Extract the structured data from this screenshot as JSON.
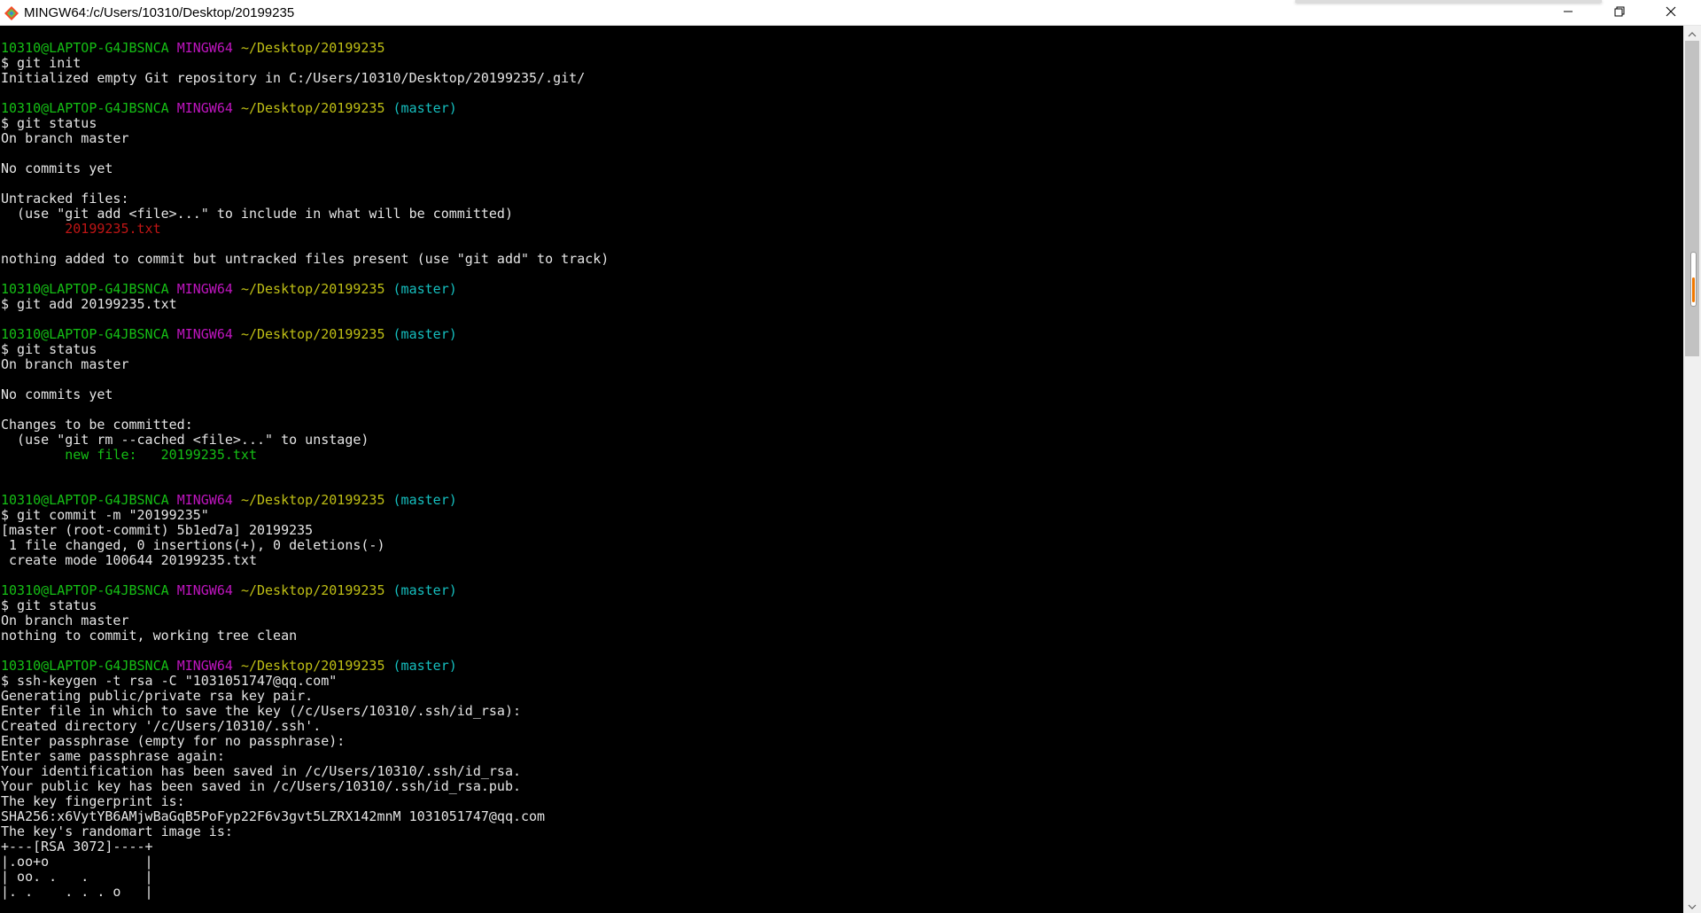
{
  "window": {
    "title": "MINGW64:/c/Users/10310/Desktop/20199235",
    "icon": "git-bash-icon",
    "controls": [
      "minimize-icon",
      "maximize-icon",
      "close-icon"
    ]
  },
  "colors": {
    "user_host": "#15bf15",
    "mingw": "#bf15bf",
    "path": "#bfbf15",
    "branch": "#15bfbf",
    "untracked": "#bf1515",
    "staged": "#15bf15",
    "text": "#e5e5e5",
    "background": "#000000"
  },
  "terminal": {
    "lines": [
      {
        "segs": [
          {
            "t": "10310@LAPTOP-G4JBSNCA",
            "c": "user"
          },
          {
            "t": " "
          },
          {
            "t": "MINGW64",
            "c": "host"
          },
          {
            "t": " "
          },
          {
            "t": "~/Desktop/20199235",
            "c": "path"
          }
        ]
      },
      {
        "segs": [
          {
            "t": "$ git init"
          }
        ]
      },
      {
        "segs": [
          {
            "t": "Initialized empty Git repository in C:/Users/10310/Desktop/20199235/.git/"
          }
        ]
      },
      {
        "segs": []
      },
      {
        "segs": [
          {
            "t": "10310@LAPTOP-G4JBSNCA",
            "c": "user"
          },
          {
            "t": " "
          },
          {
            "t": "MINGW64",
            "c": "host"
          },
          {
            "t": " "
          },
          {
            "t": "~/Desktop/20199235",
            "c": "path"
          },
          {
            "t": " "
          },
          {
            "t": "(master)",
            "c": "branch"
          }
        ]
      },
      {
        "segs": [
          {
            "t": "$ git status"
          }
        ]
      },
      {
        "segs": [
          {
            "t": "On branch master"
          }
        ]
      },
      {
        "segs": []
      },
      {
        "segs": [
          {
            "t": "No commits yet"
          }
        ]
      },
      {
        "segs": []
      },
      {
        "segs": [
          {
            "t": "Untracked files:"
          }
        ]
      },
      {
        "segs": [
          {
            "t": "  (use \"git add <file>...\" to include in what will be committed)"
          }
        ]
      },
      {
        "segs": [
          {
            "t": "        "
          },
          {
            "t": "20199235.txt",
            "c": "red"
          }
        ]
      },
      {
        "segs": []
      },
      {
        "segs": [
          {
            "t": "nothing added to commit but untracked files present (use \"git add\" to track)"
          }
        ]
      },
      {
        "segs": []
      },
      {
        "segs": [
          {
            "t": "10310@LAPTOP-G4JBSNCA",
            "c": "user"
          },
          {
            "t": " "
          },
          {
            "t": "MINGW64",
            "c": "host"
          },
          {
            "t": " "
          },
          {
            "t": "~/Desktop/20199235",
            "c": "path"
          },
          {
            "t": " "
          },
          {
            "t": "(master)",
            "c": "branch"
          }
        ]
      },
      {
        "segs": [
          {
            "t": "$ git add 20199235.txt"
          }
        ]
      },
      {
        "segs": []
      },
      {
        "segs": [
          {
            "t": "10310@LAPTOP-G4JBSNCA",
            "c": "user"
          },
          {
            "t": " "
          },
          {
            "t": "MINGW64",
            "c": "host"
          },
          {
            "t": " "
          },
          {
            "t": "~/Desktop/20199235",
            "c": "path"
          },
          {
            "t": " "
          },
          {
            "t": "(master)",
            "c": "branch"
          }
        ]
      },
      {
        "segs": [
          {
            "t": "$ git status"
          }
        ]
      },
      {
        "segs": [
          {
            "t": "On branch master"
          }
        ]
      },
      {
        "segs": []
      },
      {
        "segs": [
          {
            "t": "No commits yet"
          }
        ]
      },
      {
        "segs": []
      },
      {
        "segs": [
          {
            "t": "Changes to be committed:"
          }
        ]
      },
      {
        "segs": [
          {
            "t": "  (use \"git rm --cached <file>...\" to unstage)"
          }
        ]
      },
      {
        "segs": [
          {
            "t": "        "
          },
          {
            "t": "new file:   20199235.txt",
            "c": "green"
          }
        ]
      },
      {
        "segs": []
      },
      {
        "segs": []
      },
      {
        "segs": [
          {
            "t": "10310@LAPTOP-G4JBSNCA",
            "c": "user"
          },
          {
            "t": " "
          },
          {
            "t": "MINGW64",
            "c": "host"
          },
          {
            "t": " "
          },
          {
            "t": "~/Desktop/20199235",
            "c": "path"
          },
          {
            "t": " "
          },
          {
            "t": "(master)",
            "c": "branch"
          }
        ]
      },
      {
        "segs": [
          {
            "t": "$ git commit -m \"20199235\""
          }
        ]
      },
      {
        "segs": [
          {
            "t": "[master (root-commit) 5b1ed7a] 20199235"
          }
        ]
      },
      {
        "segs": [
          {
            "t": " 1 file changed, 0 insertions(+), 0 deletions(-)"
          }
        ]
      },
      {
        "segs": [
          {
            "t": " create mode 100644 20199235.txt"
          }
        ]
      },
      {
        "segs": []
      },
      {
        "segs": [
          {
            "t": "10310@LAPTOP-G4JBSNCA",
            "c": "user"
          },
          {
            "t": " "
          },
          {
            "t": "MINGW64",
            "c": "host"
          },
          {
            "t": " "
          },
          {
            "t": "~/Desktop/20199235",
            "c": "path"
          },
          {
            "t": " "
          },
          {
            "t": "(master)",
            "c": "branch"
          }
        ]
      },
      {
        "segs": [
          {
            "t": "$ git status"
          }
        ]
      },
      {
        "segs": [
          {
            "t": "On branch master"
          }
        ]
      },
      {
        "segs": [
          {
            "t": "nothing to commit, working tree clean"
          }
        ]
      },
      {
        "segs": []
      },
      {
        "segs": [
          {
            "t": "10310@LAPTOP-G4JBSNCA",
            "c": "user"
          },
          {
            "t": " "
          },
          {
            "t": "MINGW64",
            "c": "host"
          },
          {
            "t": " "
          },
          {
            "t": "~/Desktop/20199235",
            "c": "path"
          },
          {
            "t": " "
          },
          {
            "t": "(master)",
            "c": "branch"
          }
        ]
      },
      {
        "segs": [
          {
            "t": "$ ssh-keygen -t rsa -C \"1031051747@qq.com\""
          }
        ]
      },
      {
        "segs": [
          {
            "t": "Generating public/private rsa key pair."
          }
        ]
      },
      {
        "segs": [
          {
            "t": "Enter file in which to save the key (/c/Users/10310/.ssh/id_rsa):"
          }
        ]
      },
      {
        "segs": [
          {
            "t": "Created directory '/c/Users/10310/.ssh'."
          }
        ]
      },
      {
        "segs": [
          {
            "t": "Enter passphrase (empty for no passphrase):"
          }
        ]
      },
      {
        "segs": [
          {
            "t": "Enter same passphrase again:"
          }
        ]
      },
      {
        "segs": [
          {
            "t": "Your identification has been saved in /c/Users/10310/.ssh/id_rsa."
          }
        ]
      },
      {
        "segs": [
          {
            "t": "Your public key has been saved in /c/Users/10310/.ssh/id_rsa.pub."
          }
        ]
      },
      {
        "segs": [
          {
            "t": "The key fingerprint is:"
          }
        ]
      },
      {
        "segs": [
          {
            "t": "SHA256:x6VytYB6AMjwBaGqB5PoFyp22F6v3gvt5LZRX142mnM 1031051747@qq.com"
          }
        ]
      },
      {
        "segs": [
          {
            "t": "The key's randomart image is:"
          }
        ]
      },
      {
        "segs": [
          {
            "t": "+---[RSA 3072]----+"
          }
        ]
      },
      {
        "segs": [
          {
            "t": "|.oo+o            |"
          }
        ]
      },
      {
        "segs": [
          {
            "t": "| oo. .   .       |"
          }
        ]
      },
      {
        "segs": [
          {
            "t": "|. .    . . . o   |"
          }
        ]
      }
    ]
  },
  "scrollbar": {
    "up_icon": "scroll-up-arrow-icon",
    "down_icon": "scroll-down-arrow-icon"
  }
}
